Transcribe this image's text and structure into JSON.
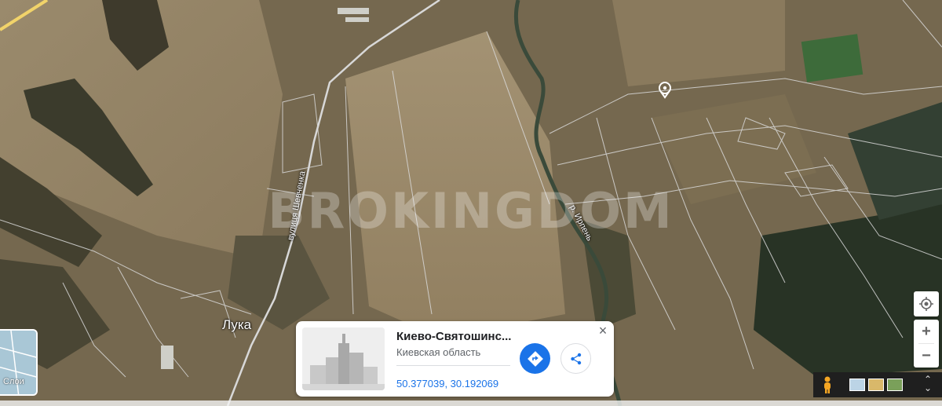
{
  "map": {
    "place_label": "Лука",
    "street_label": "вулиця Шевченка",
    "river_label": "р. Ирпень",
    "watermark": "BROKINGDOM"
  },
  "card": {
    "title": "Киево-Святошинс...",
    "subtitle": "Киевская область",
    "coords": "50.377039, 30.192069",
    "close_label": "×"
  },
  "controls": {
    "zoom_in_label": "+",
    "zoom_out_label": "−",
    "layers_label": "Слои"
  },
  "icons": {
    "place_pin": "map-pin-icon",
    "directions": "directions-icon",
    "share": "share-icon",
    "locate": "my-location-icon",
    "pegman": "street-view-icon",
    "expand": "expand-icon"
  },
  "colors": {
    "accent": "#1a73e8",
    "card_background": "#ffffff"
  }
}
